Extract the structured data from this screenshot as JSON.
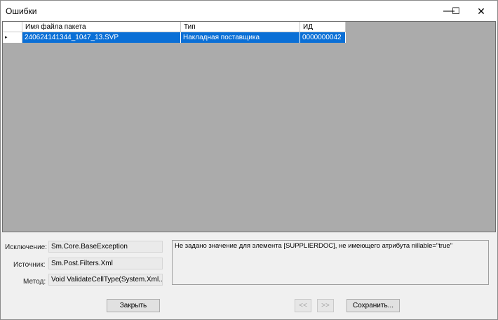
{
  "window": {
    "title": "Ошибки",
    "controls": {
      "minimize": "—",
      "maximize": "☐",
      "close": "✕"
    }
  },
  "grid": {
    "columns": [
      "Имя файла пакета",
      "Тип",
      "ИД"
    ],
    "rows": [
      {
        "marker": "▸",
        "file": "240624141344_1047_13.SVP",
        "type": "Накладная поставщика",
        "id": "0000000042"
      }
    ]
  },
  "details": {
    "exception_label": "Исключение:",
    "exception_value": "Sm.Core.BaseException",
    "source_label": "Источник:",
    "source_value": "Sm.Post.Filters.Xml",
    "method_label": "Метод:",
    "method_value": "Void ValidateCellType(System.Xml....",
    "message": "Не задано значение для элемента [SUPPLIERDOC], не имеющего атрибута nillable=\"true\""
  },
  "buttons": {
    "close": "Закрыть",
    "prev": "<<",
    "next": ">>",
    "save": "Сохранить..."
  }
}
